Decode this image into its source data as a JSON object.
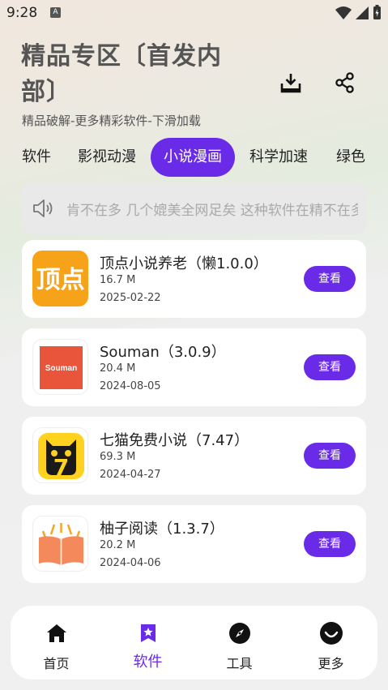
{
  "status": {
    "time": "9:28",
    "notif": "A"
  },
  "header": {
    "title": "精品专区〔首发内部〕",
    "subtitle": "精品破解-更多精彩软件-下滑加载"
  },
  "tabs": [
    "软件",
    "影视动漫",
    "小说漫画",
    "科学加速",
    "绿色"
  ],
  "active_tab": "小说漫画",
  "notice": {
    "text": "肯不在多 几个媲美全网足矣  这种软件在精不在多"
  },
  "apps": [
    {
      "name": "顶点小说养老（懒1.0.0）",
      "size": "16.7 M",
      "date": "2025-02-22",
      "button": "查看",
      "icon_text": "顶点",
      "icon": "dingdian-logo"
    },
    {
      "name": "Souman（3.0.9）",
      "size": "20.4 M",
      "date": "2024-08-05",
      "button": "查看",
      "icon_text": "Souman",
      "icon": "souman-logo"
    },
    {
      "name": "七猫免费小说（7.47）",
      "size": "69.3 M",
      "date": "2024-04-27",
      "button": "查看",
      "icon_text": "7",
      "icon": "qimao-logo"
    },
    {
      "name": "柚子阅读（1.3.7）",
      "size": "20.2 M",
      "date": "2024-04-06",
      "button": "查看",
      "icon": "book-logo"
    }
  ],
  "nav": [
    {
      "label": "首页",
      "icon": "home-icon"
    },
    {
      "label": "软件",
      "icon": "star-bookmark-icon",
      "active": true
    },
    {
      "label": "工具",
      "icon": "compass-icon"
    },
    {
      "label": "更多",
      "icon": "smile-icon"
    }
  ],
  "colors": {
    "accent": "#6a2be8",
    "card": "#ffffff",
    "background": "#f0f0f0"
  }
}
